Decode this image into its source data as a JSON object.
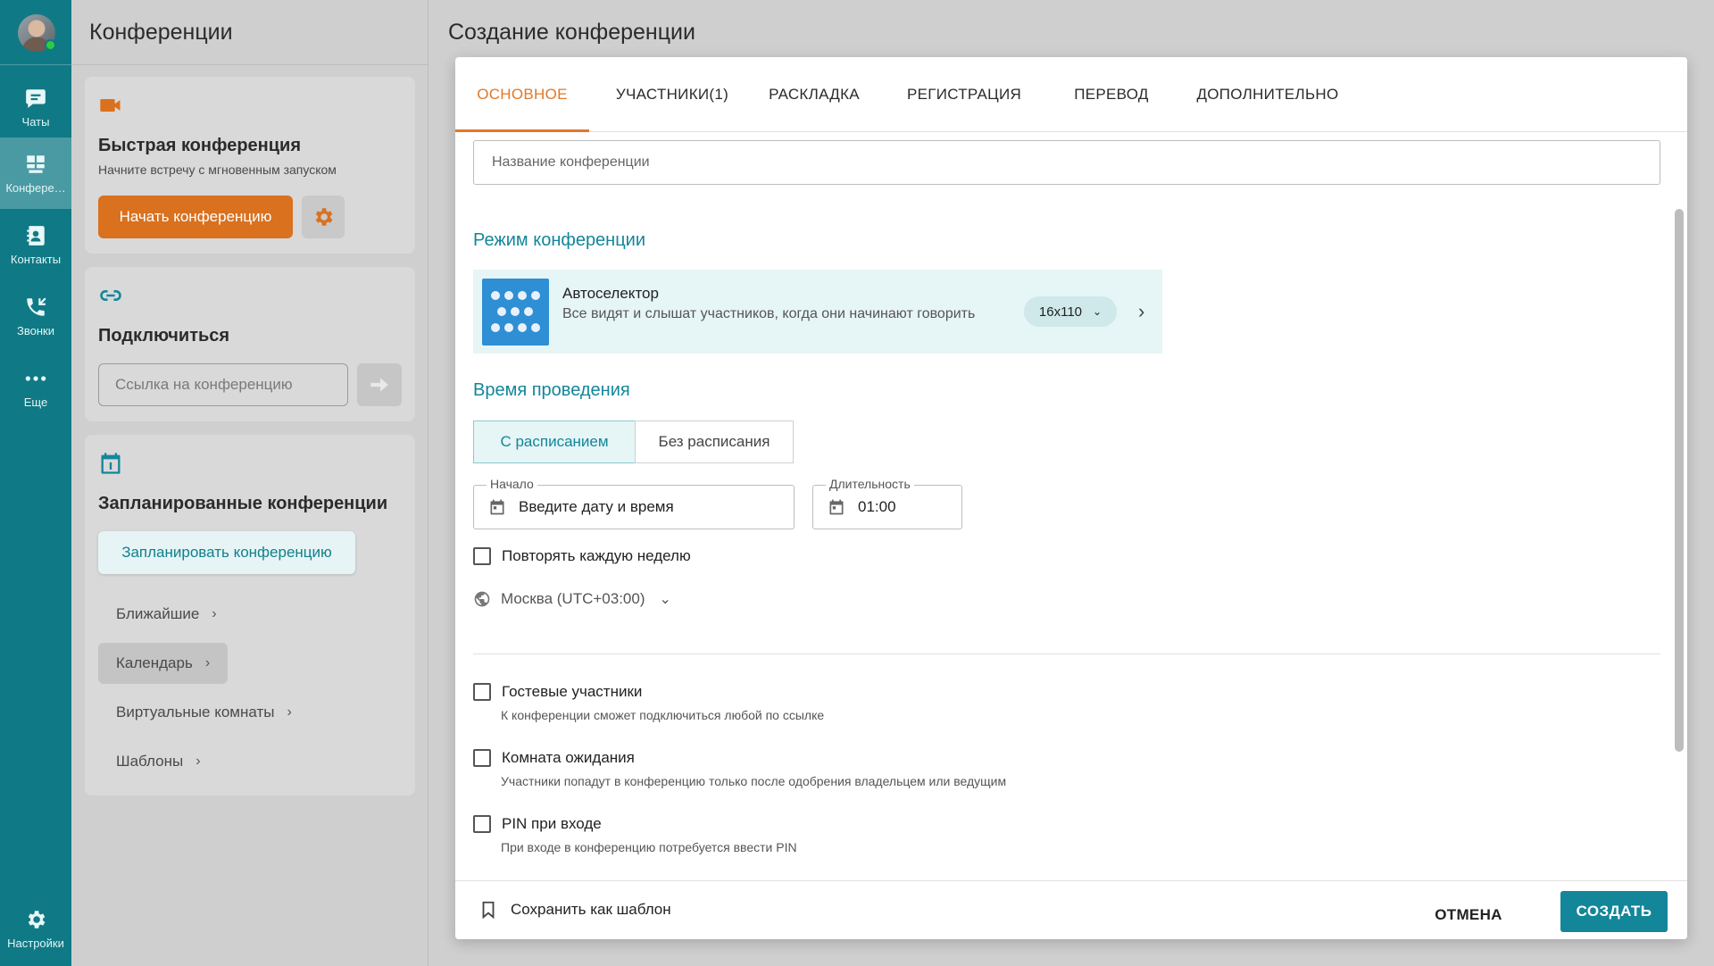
{
  "rail": {
    "items": [
      {
        "label": "Чаты",
        "icon": "chat-icon"
      },
      {
        "label": "Конфере…",
        "icon": "conference-icon",
        "active": true
      },
      {
        "label": "Контакты",
        "icon": "contacts-icon"
      },
      {
        "label": "Звонки",
        "icon": "calls-icon"
      },
      {
        "label": "Еще",
        "icon": "more-icon"
      }
    ],
    "settings_label": "Настройки"
  },
  "panel": {
    "title": "Конференции",
    "quick": {
      "title": "Быстрая конференция",
      "subtitle": "Начните встречу с мгновенным запуском",
      "start_label": "Начать конференцию"
    },
    "connect": {
      "title": "Подключиться",
      "placeholder": "Ссылка на конференцию"
    },
    "scheduled": {
      "title": "Запланированные конференции",
      "schedule_label": "Запланировать конференцию",
      "items": [
        "Ближайшие",
        "Календарь",
        "Виртуальные комнаты",
        "Шаблоны"
      ],
      "active_item": "Календарь"
    }
  },
  "main": {
    "title": "Создание конференции",
    "tabs": [
      "ОСНОВНОЕ",
      "УЧАСТНИКИ(1)",
      "РАСКЛАДКА",
      "РЕГИСТРАЦИЯ",
      "ПЕРЕВОД",
      "ДОПОЛНИТЕЛЬНО"
    ],
    "active_tab": "ОСНОВНОЕ",
    "name_placeholder": "Название конференции",
    "mode_section": "Режим конференции",
    "mode": {
      "title": "Автоселектор",
      "description": "Все видят и слышат участников, когда они начинают говорить",
      "layout": "16x110"
    },
    "time_section": "Время проведения",
    "schedule_options": [
      "С расписанием",
      "Без расписания"
    ],
    "schedule_active": "С расписанием",
    "start": {
      "label": "Начало",
      "placeholder": "Введите дату и время"
    },
    "duration": {
      "label": "Длительность",
      "value": "01:00"
    },
    "repeat_label": "Повторять каждую неделю",
    "timezone": "Москва (UTC+03:00)",
    "options": [
      {
        "label": "Гостевые участники",
        "hint": "К конференции сможет подключиться любой по ссылке"
      },
      {
        "label": "Комната ожидания",
        "hint": "Участники попадут в конференцию только после одобрения владельцем или ведущим"
      },
      {
        "label": "PIN при входе",
        "hint": "При входе в конференцию потребуется ввести PIN"
      }
    ],
    "footer": {
      "save_template": "Сохранить как шаблон",
      "cancel": "ОТМЕНА",
      "create": "СОЗДАТЬ"
    }
  },
  "colors": {
    "rail": "#0f7a85",
    "accent_teal": "#13869a",
    "accent_orange": "#d9711f"
  }
}
